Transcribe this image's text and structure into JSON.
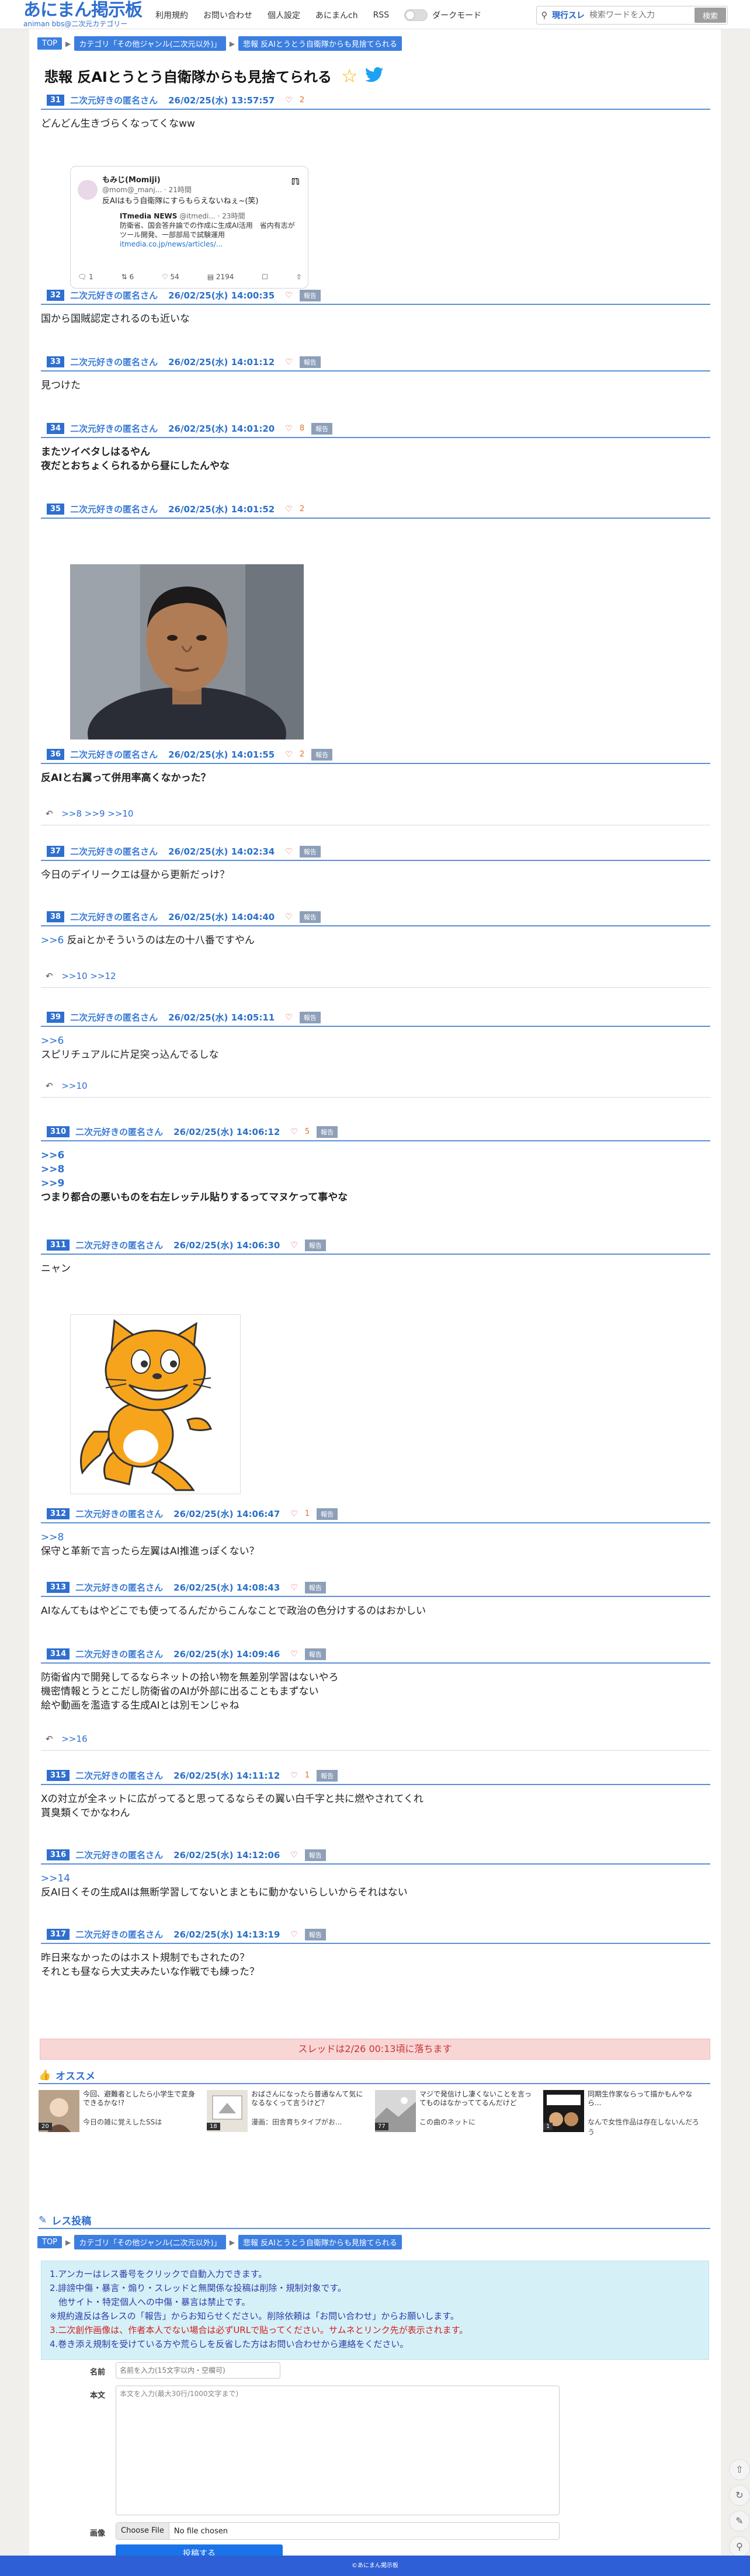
{
  "header": {
    "logo_title": "あにまん掲示板",
    "logo_sub": "animan bbs@二次元カテゴリー",
    "nav": [
      "利用規約",
      "お問い合わせ",
      "個人設定",
      "あにまんch",
      "RSS"
    ],
    "dark_mode_label": "ダークモード",
    "search_scope": "現行スレ",
    "search_placeholder": "検索ワードを入力",
    "search_button": "検索"
  },
  "breadcrumb": [
    "TOP",
    "カテゴリ「その他ジャンル(二次元以外)」",
    "悲報 反AIとうとう自衛隊からも見捨てられる"
  ],
  "thread_title": "悲報 反AIとうとう自衛隊からも見捨てられる",
  "posts": [
    {
      "num": "31",
      "name": "二次元好きの匿名さん",
      "date": "26/02/25(水) 13:57:57",
      "likes": "2",
      "lines": [
        "どんどん生きづらくなってくなww"
      ]
    },
    {
      "num": "32",
      "name": "二次元好きの匿名さん",
      "date": "26/02/25(水) 14:00:35",
      "report": "報告",
      "lines": [
        "国から国賊認定されるのも近いな"
      ]
    },
    {
      "num": "33",
      "name": "二次元好きの匿名さん",
      "date": "26/02/25(水) 14:01:12",
      "report": "報告",
      "lines": [
        "見つけた"
      ]
    },
    {
      "num": "34",
      "name": "二次元好きの匿名さん",
      "date": "26/02/25(水) 14:01:20",
      "likes": "8",
      "report": "報告",
      "lines": [
        "またツイベタしはるやん",
        "夜だとおちょくられるから昼にしたんやな"
      ]
    },
    {
      "num": "35",
      "name": "二次元好きの匿名さん",
      "date": "26/02/25(水) 14:01:52",
      "likes": "2"
    },
    {
      "num": "36",
      "name": "二次元好きの匿名さん",
      "date": "26/02/25(水) 14:01:55",
      "likes": "2",
      "report": "報告",
      "lines": [
        "反AIと右翼って併用率高くなかった？"
      ],
      "replies": ">>8 >>9 >>10"
    },
    {
      "num": "37",
      "name": "二次元好きの匿名さん",
      "date": "26/02/25(水) 14:02:34",
      "report": "報告",
      "lines": [
        "今日のデイリークエは昼から更新だっけ？"
      ]
    },
    {
      "num": "38",
      "name": "二次元好きの匿名さん",
      "date": "26/02/25(水) 14:04:40",
      "report": "報告",
      "anchor": ">>6",
      "lines": [
        "反aiとかそういうのは左の十八番ですやん"
      ],
      "replies": ">>10 >>12"
    },
    {
      "num": "39",
      "name": "二次元好きの匿名さん",
      "date": "26/02/25(水) 14:05:11",
      "report": "報告",
      "anchor": ">>6",
      "lines": [
        "スピリチュアルに片足突っ込んでるしな"
      ],
      "replies": ">>10"
    },
    {
      "num": "310",
      "name": "二次元好きの匿名さん",
      "date": "26/02/25(水) 14:06:12",
      "likes": "5",
      "report": "報告",
      "anchors": [
        ">>6",
        ">>8",
        ">>9"
      ],
      "lines": [
        "つまり都合の悪いものを右左レッテル貼りするってマヌケって事やな"
      ]
    },
    {
      "num": "311",
      "name": "二次元好きの匿名さん",
      "date": "26/02/25(水) 14:06:30",
      "report": "報告",
      "lines": [
        "ニャン"
      ]
    },
    {
      "num": "312",
      "name": "二次元好きの匿名さん",
      "date": "26/02/25(水) 14:06:47",
      "likes": "1",
      "report": "報告",
      "anchor": ">>8",
      "lines": [
        "保守と革新で言ったら左翼はAI推進っぽくない？"
      ]
    },
    {
      "num": "313",
      "name": "二次元好きの匿名さん",
      "date": "26/02/25(水) 14:08:43",
      "report": "報告",
      "lines": [
        "AIなんてもはやどこでも使ってるんだからこんなことで政治の色分けするのはおかしい"
      ]
    },
    {
      "num": "314",
      "name": "二次元好きの匿名さん",
      "date": "26/02/25(水) 14:09:46",
      "report": "報告",
      "lines": [
        "防衛省内で開発してるならネットの拾い物を無差別学習はないやろ",
        "機密情報とうとこだし防衛省のAIが外部に出ることもまずない",
        "絵や動画を濫造する生成AIとは別モンじゃね"
      ],
      "replies": ">>16"
    },
    {
      "num": "315",
      "name": "二次元好きの匿名さん",
      "date": "26/02/25(水) 14:11:12",
      "likes": "1",
      "report": "報告",
      "lines": [
        "Xの対立が全ネットに広がってると思ってるならその翼い白千字と共に燃やされてくれ",
        "貰臭類くでかなわん"
      ]
    },
    {
      "num": "316",
      "name": "二次元好きの匿名さん",
      "date": "26/02/25(水) 14:12:06",
      "report": "報告",
      "anchor": ">>14",
      "lines": [
        "反AI日くその生成AIは無断学習してないとまともに動かないらしいからそれはない"
      ]
    },
    {
      "num": "317",
      "name": "二次元好きの匿名さん",
      "date": "26/02/25(水) 14:13:19",
      "report": "報告",
      "lines": [
        "昨日来なかったのはホスト規制でもされたの？",
        "それとも昼なら大丈夫みたいな作戦でも練った？"
      ]
    }
  ],
  "embed": {
    "user_name": "もみじ(Momiji)",
    "user_handle": "@mom@_manj... · 21時間",
    "user_text": "反AIはもう自衛隊にすらもらえないねぇ~(笑)",
    "quote_name": "ITmedia NEWS",
    "quote_handle": "@itmedi... · 23時間",
    "quote_text": "防衛省、国会答弁論での作成に生成AI活用　省内有志がツール開発、一部部局で試験運用",
    "quote_link": "itmedia.co.jp/news/articles/...",
    "actions": [
      "1",
      "6",
      "54",
      "2194"
    ]
  },
  "drop_notice": "スレッドは2/26 00:13頃に落ちます",
  "recommend": {
    "title": "オススメ",
    "items": [
      {
        "title": "今回、避難者としたら小学生で変身できるかな!?",
        "sub": "今日の雑に覚えしたSSは",
        "badge": "20"
      },
      {
        "title": "おばさんになったら普通なんて気になるなくって言うけど？",
        "sub": "漫画：田舎育ちタイプがお...",
        "badge": "18"
      },
      {
        "title": "マジで発信けし凄くないことを言ってものはなかっててるんだけど",
        "sub": "この曲のネットに",
        "badge": "77"
      },
      {
        "title": "同期生作家ならって描かもんやなら...",
        "sub": "なんで女性作品は存在しないんだろう",
        "badge": "1"
      }
    ]
  },
  "post_form": {
    "title": "レス投稿",
    "rules": [
      "1.アンカーはレス番号をクリックで自動入力できます。",
      "2.誹謗中傷・暴言・煽り・スレッドと無関係な投稿は削除・規制対象です。",
      "　他サイト・特定個人への中傷・暴言は禁止です。",
      "※規約違反は各レスの「報告」からお知らせください。削除依頼は「お問い合わせ」からお願いします。",
      "3.二次創作画像は、作者本人でない場合は必ずURLで貼ってください。サムネとリンク先が表示されます。",
      "4.巻き添え規制を受けている方や荒らしを反省した方はお問い合わせから連絡をください。"
    ],
    "name_label": "名前",
    "name_placeholder": "名前を入力(15文字以内・空欄可)",
    "body_label": "本文",
    "body_placeholder": "本文を入力(最大30行/1000文字まで)",
    "image_label": "画像",
    "file_button": "Choose File",
    "file_name": "No file chosen",
    "submit": "投稿する"
  },
  "footer": "©あにまん掲示板"
}
